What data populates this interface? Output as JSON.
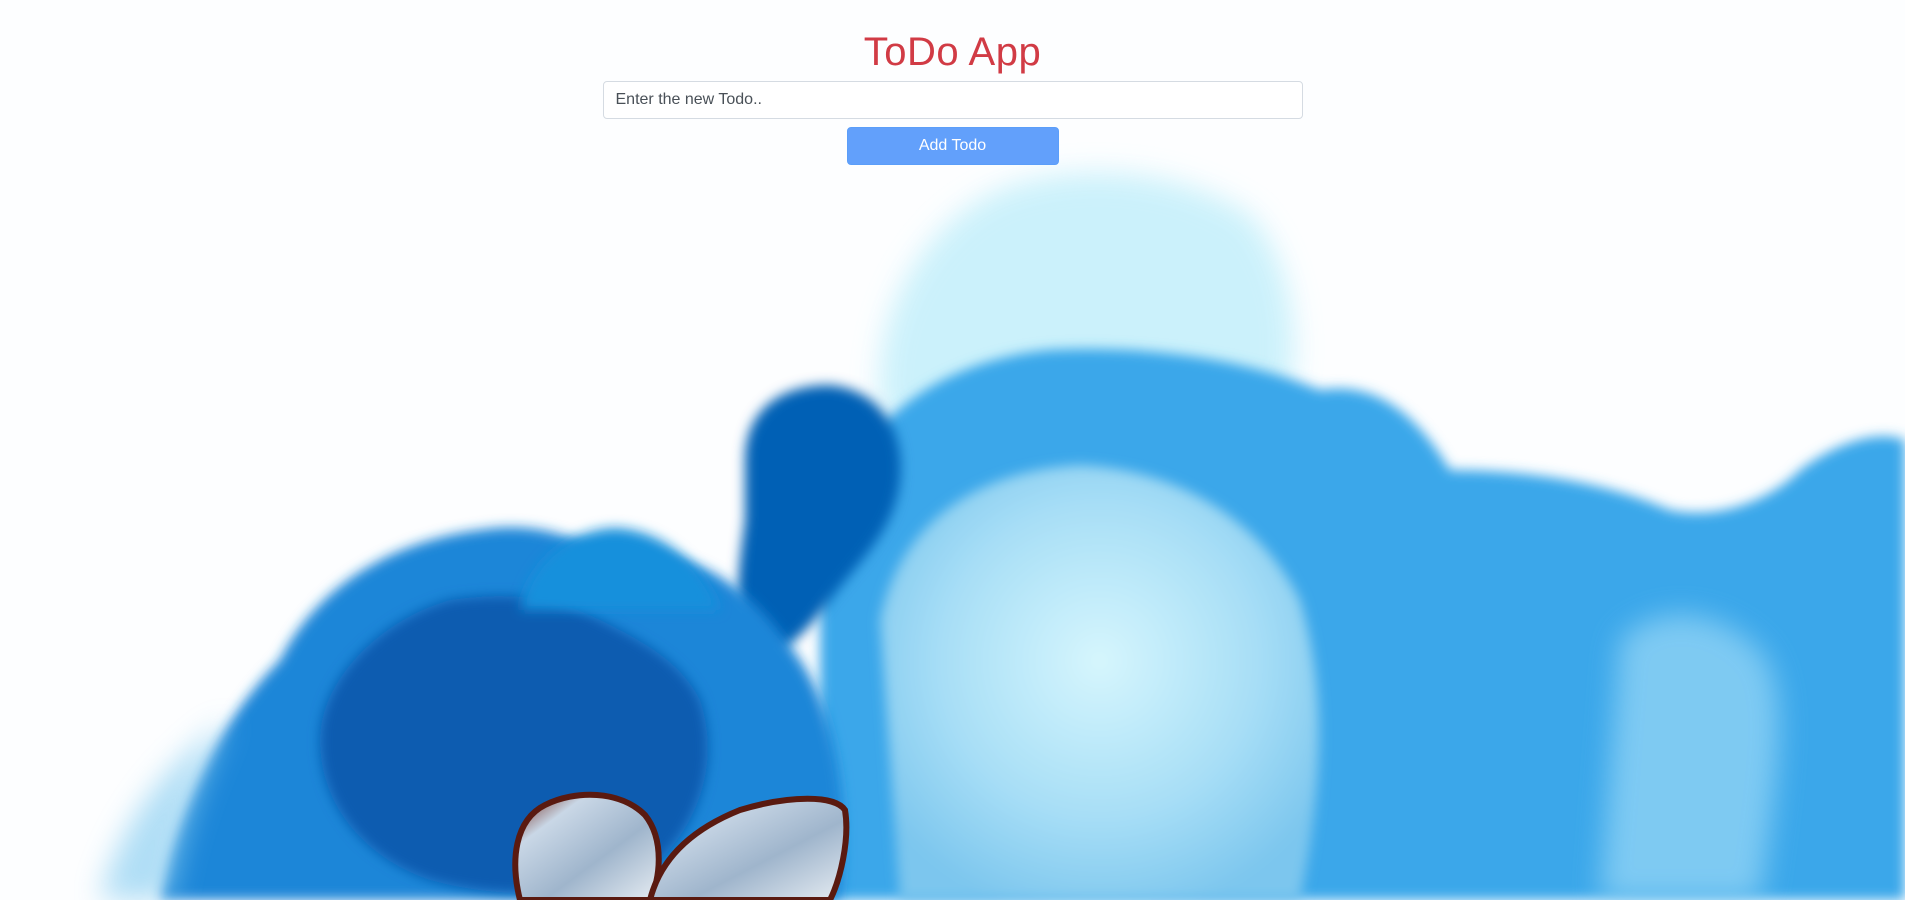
{
  "app": {
    "title": "ToDo App"
  },
  "form": {
    "input_value": "",
    "input_placeholder": "Enter the new Todo..",
    "add_button_label": "Add Todo"
  },
  "colors": {
    "title": "#d13b45",
    "button": "#62a0fb",
    "background": "#fdfeff",
    "ink_dark": "#0561b8",
    "ink_light": "#bfeefa"
  },
  "background_image": {
    "subject": "blue alcohol ink clouds with butterfly wings"
  }
}
